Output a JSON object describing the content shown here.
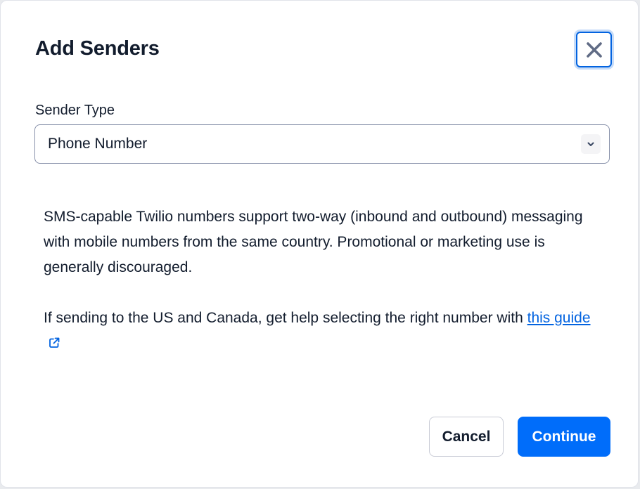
{
  "modal": {
    "title": "Add Senders",
    "close_icon": "close-icon"
  },
  "sender_type": {
    "label": "Sender Type",
    "selected": "Phone Number",
    "chevron_icon": "chevron-down-icon"
  },
  "description": {
    "paragraph_1": "SMS-capable Twilio numbers support two-way (inbound and outbound) messaging with mobile numbers from the same country. Promotional or marketing use is generally discouraged.",
    "paragraph_2_prefix": "If sending to the US and Canada, get help selecting the right number with ",
    "link_text": "this guide",
    "link_icon": "external-link-icon"
  },
  "footer": {
    "cancel_label": "Cancel",
    "continue_label": "Continue"
  },
  "colors": {
    "primary": "#006dfa",
    "link": "#0263e0",
    "text": "#121c2d",
    "focus_ring": "#c5dbf8"
  }
}
